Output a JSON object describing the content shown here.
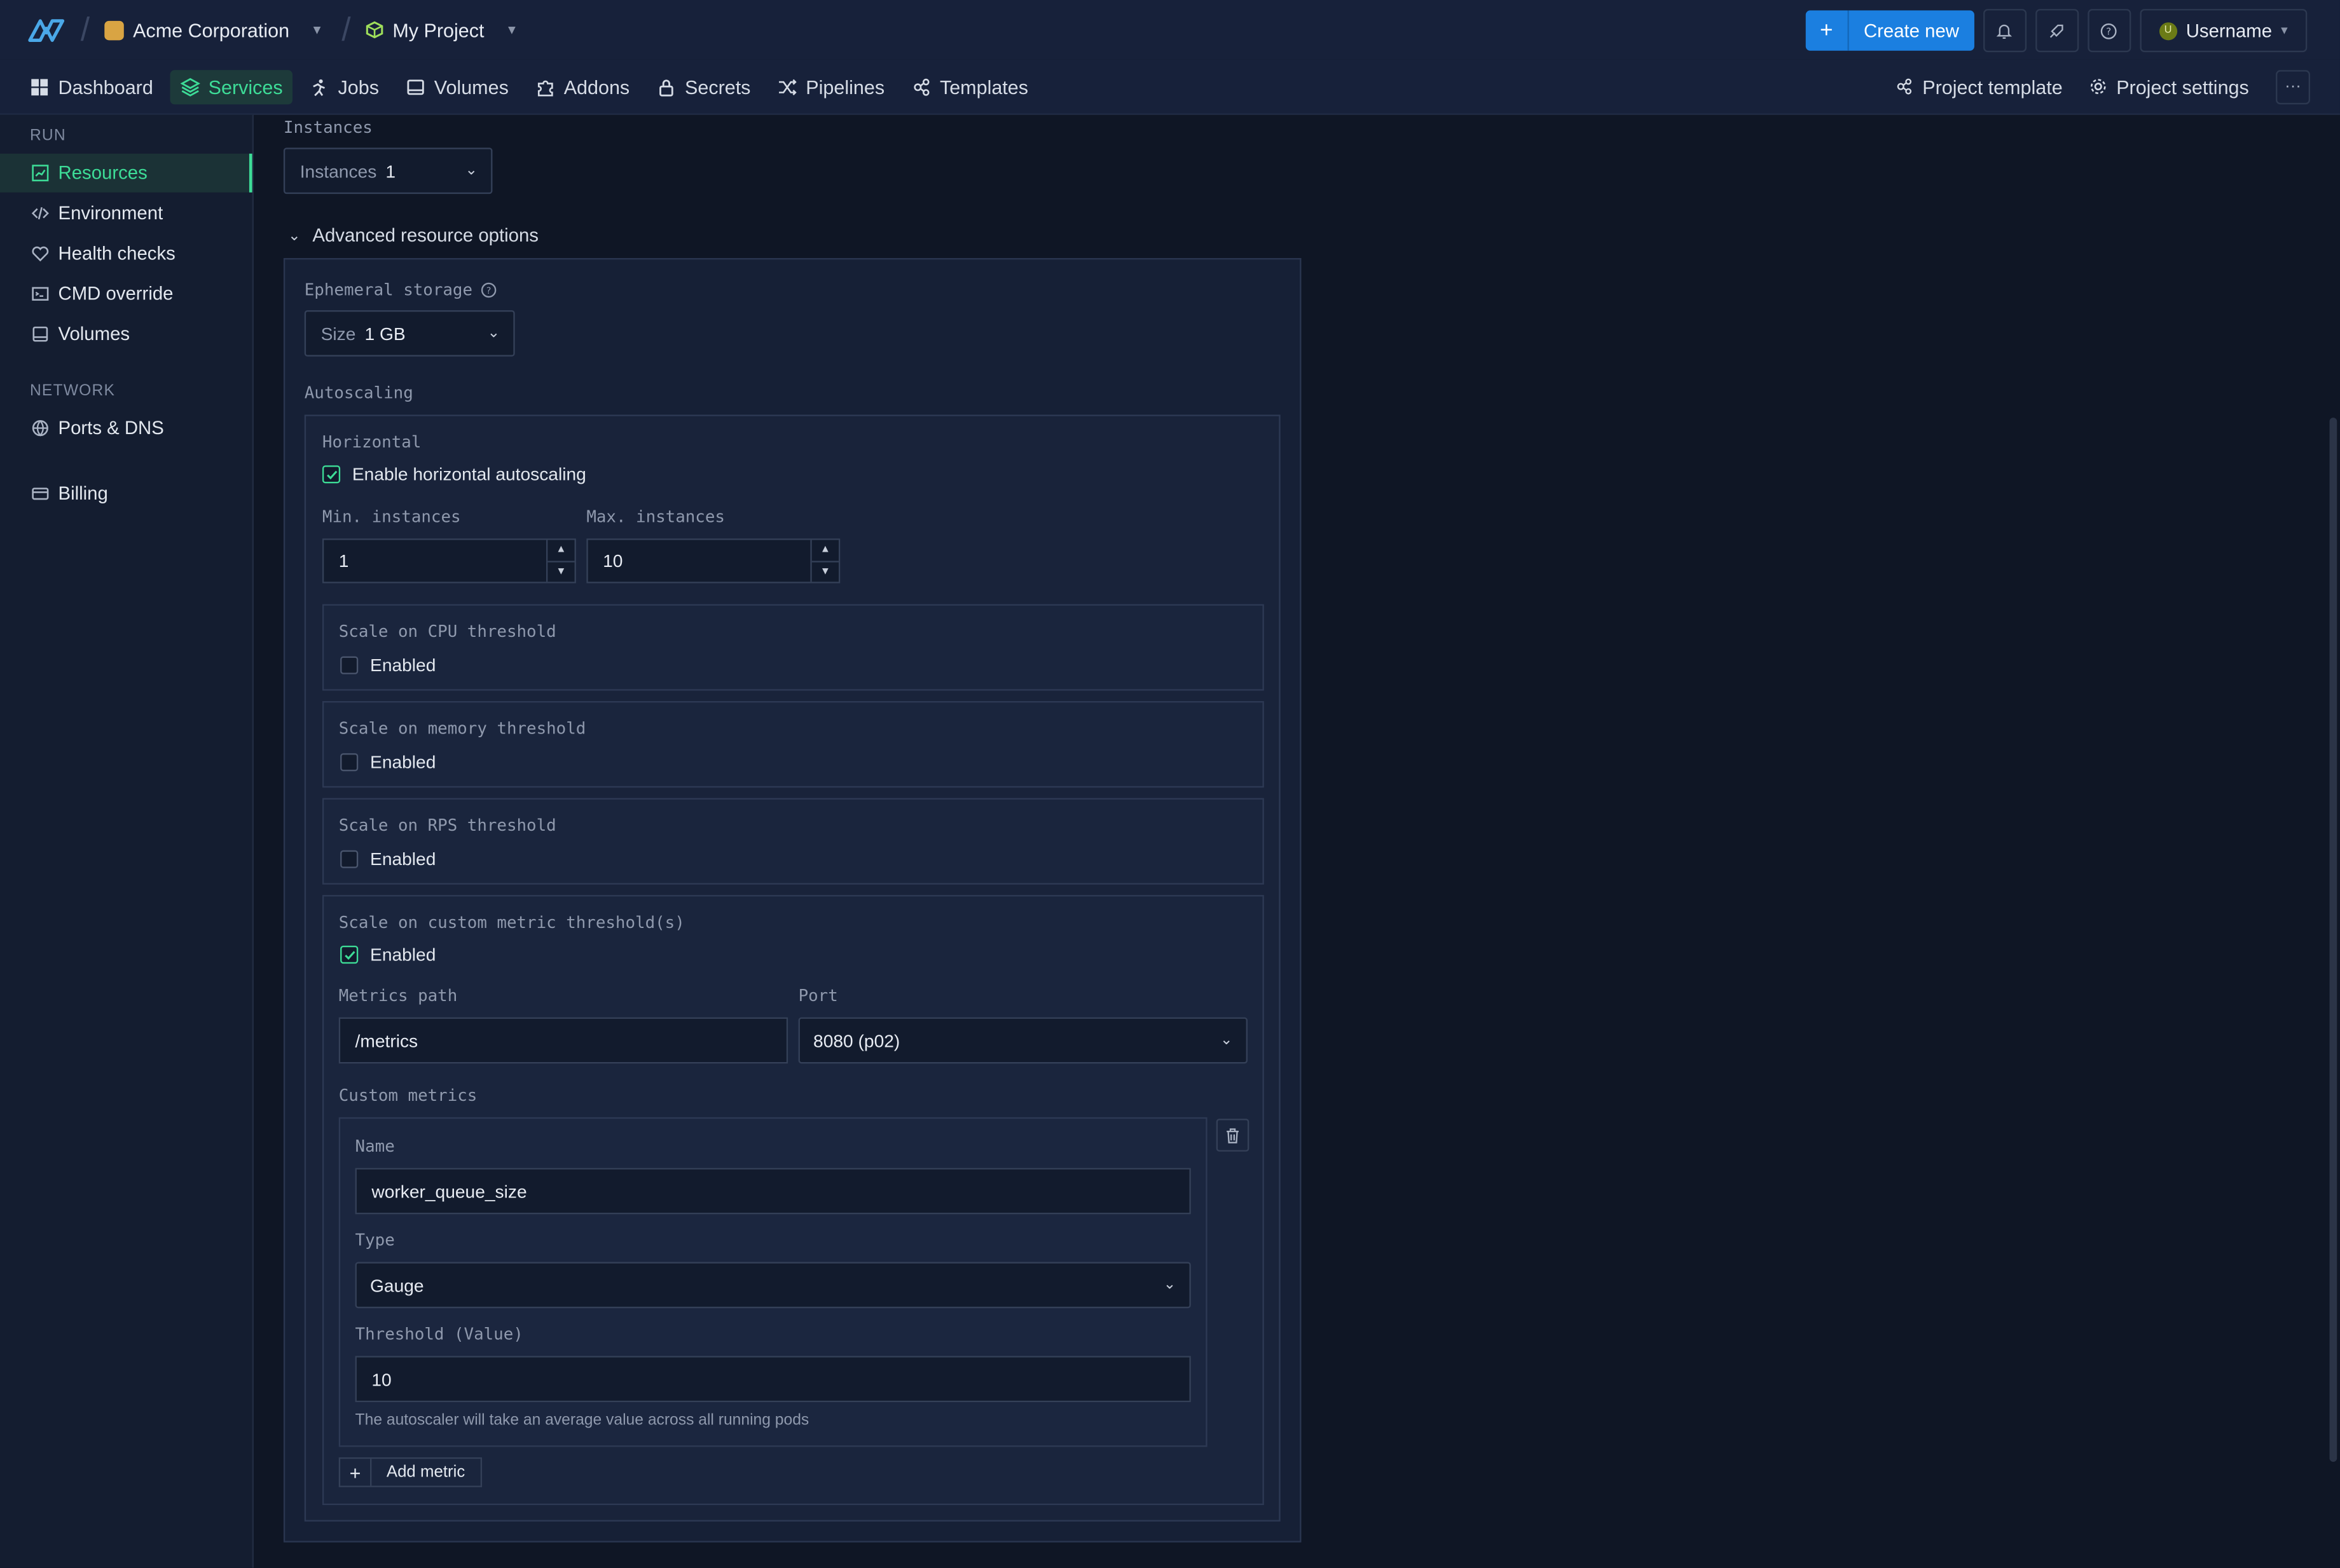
{
  "header": {
    "org": "Acme Corporation",
    "project": "My Project",
    "create_new": "Create new",
    "username": "Username",
    "avatar_initial": "U",
    "icons": [
      "bell-icon",
      "rocket-icon",
      "help-icon"
    ]
  },
  "nav": {
    "items": [
      {
        "label": "Dashboard",
        "icon": "grid-icon"
      },
      {
        "label": "Services",
        "icon": "layers-icon"
      },
      {
        "label": "Jobs",
        "icon": "runner-icon"
      },
      {
        "label": "Volumes",
        "icon": "drive-icon"
      },
      {
        "label": "Addons",
        "icon": "puzzle-icon"
      },
      {
        "label": "Secrets",
        "icon": "lock-icon"
      },
      {
        "label": "Pipelines",
        "icon": "shuffle-icon"
      },
      {
        "label": "Templates",
        "icon": "template-icon"
      }
    ],
    "active": "Services",
    "project_template": "Project template",
    "project_settings": "Project settings",
    "more": "···"
  },
  "sidebar": {
    "run_heading": "RUN",
    "run_items": [
      "Resources",
      "Environment",
      "Health checks",
      "CMD override",
      "Volumes"
    ],
    "network_heading": "NETWORK",
    "network_items": [
      "Ports & DNS"
    ],
    "billing": "Billing",
    "active": "Resources"
  },
  "main": {
    "instances_label": "Instances",
    "instances_select_key": "Instances",
    "instances_value": "1",
    "advanced_toggle": "Advanced resource options",
    "ephemeral_label": "Ephemeral storage",
    "size_key": "Size",
    "size_value": "1 GB",
    "autoscaling_label": "Autoscaling",
    "horizontal_label": "Horizontal",
    "enable_horizontal": "Enable horizontal autoscaling",
    "enable_horizontal_checked": true,
    "min_label": "Min. instances",
    "min_value": "1",
    "max_label": "Max. instances",
    "max_value": "10",
    "cpu": {
      "title": "Scale on CPU threshold",
      "enabled_label": "Enabled",
      "checked": false
    },
    "memory": {
      "title": "Scale on memory threshold",
      "enabled_label": "Enabled",
      "checked": false
    },
    "rps": {
      "title": "Scale on RPS threshold",
      "enabled_label": "Enabled",
      "checked": false
    },
    "custom": {
      "title": "Scale on custom metric threshold(s)",
      "enabled_label": "Enabled",
      "checked": true,
      "metrics_path_label": "Metrics path",
      "metrics_path_value": "/metrics",
      "port_label": "Port",
      "port_value": "8080 (p02)",
      "custom_metrics_label": "Custom metrics",
      "name_label": "Name",
      "name_value": "worker_queue_size",
      "type_label": "Type",
      "type_value": "Gauge",
      "threshold_label": "Threshold (Value)",
      "threshold_value": "10",
      "hint": "The autoscaler will take an average value across all running pods",
      "add_metric": "Add metric"
    }
  },
  "colors": {
    "accent": "#3ddc97",
    "primary": "#1b7fe0",
    "bg": "#0f1625"
  }
}
